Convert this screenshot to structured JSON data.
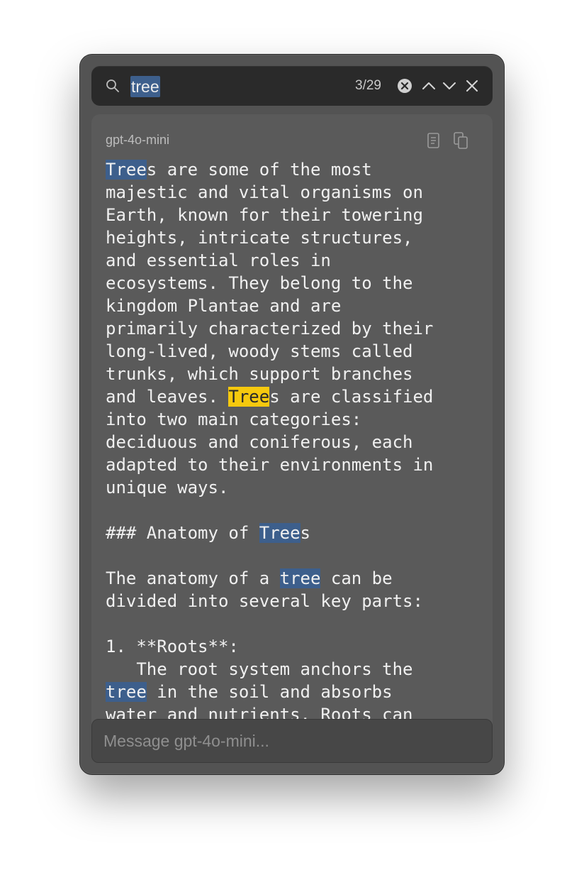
{
  "search": {
    "query": "tree",
    "match_count": "3/29"
  },
  "message": {
    "model": "gpt-4o-mini",
    "lines": [
      [
        {
          "t": "Tree",
          "h": 1
        },
        {
          "t": "s are some of the most"
        }
      ],
      [
        {
          "t": "majestic and vital organisms on"
        }
      ],
      [
        {
          "t": "Earth, known for their towering"
        }
      ],
      [
        {
          "t": "heights, intricate structures,"
        }
      ],
      [
        {
          "t": "and essential roles in"
        }
      ],
      [
        {
          "t": "ecosystems. They belong to the"
        }
      ],
      [
        {
          "t": "kingdom Plantae and are"
        }
      ],
      [
        {
          "t": "primarily characterized by their"
        }
      ],
      [
        {
          "t": "long-lived, woody stems called"
        }
      ],
      [
        {
          "t": "trunks, which support branches"
        }
      ],
      [
        {
          "t": "and leaves. "
        },
        {
          "t": "Tree",
          "h": 2
        },
        {
          "t": "s are classified"
        }
      ],
      [
        {
          "t": "into two main categories:"
        }
      ],
      [
        {
          "t": "deciduous and coniferous, each"
        }
      ],
      [
        {
          "t": "adapted to their environments in"
        }
      ],
      [
        {
          "t": "unique ways."
        }
      ],
      [
        {
          "t": ""
        }
      ],
      [
        {
          "t": "### Anatomy of "
        },
        {
          "t": "Tree",
          "h": 1
        },
        {
          "t": "s"
        }
      ],
      [
        {
          "t": ""
        }
      ],
      [
        {
          "t": "The anatomy of a "
        },
        {
          "t": "tree",
          "h": 1
        },
        {
          "t": " can be"
        }
      ],
      [
        {
          "t": "divided into several key parts:"
        }
      ],
      [
        {
          "t": ""
        }
      ],
      [
        {
          "t": "1. **Roots**:"
        }
      ],
      [
        {
          "t": "   The root system anchors the"
        }
      ],
      [
        {
          "t": "tree",
          "h": 1
        },
        {
          "t": " in the soil and absorbs"
        }
      ],
      [
        {
          "t": "water and nutrients. Roots can"
        }
      ]
    ]
  },
  "composer": {
    "placeholder": "Message gpt-4o-mini..."
  },
  "colors": {
    "highlight": "#3d5f8c",
    "current_highlight": "#f6c90e",
    "window_bg": "#535353"
  }
}
